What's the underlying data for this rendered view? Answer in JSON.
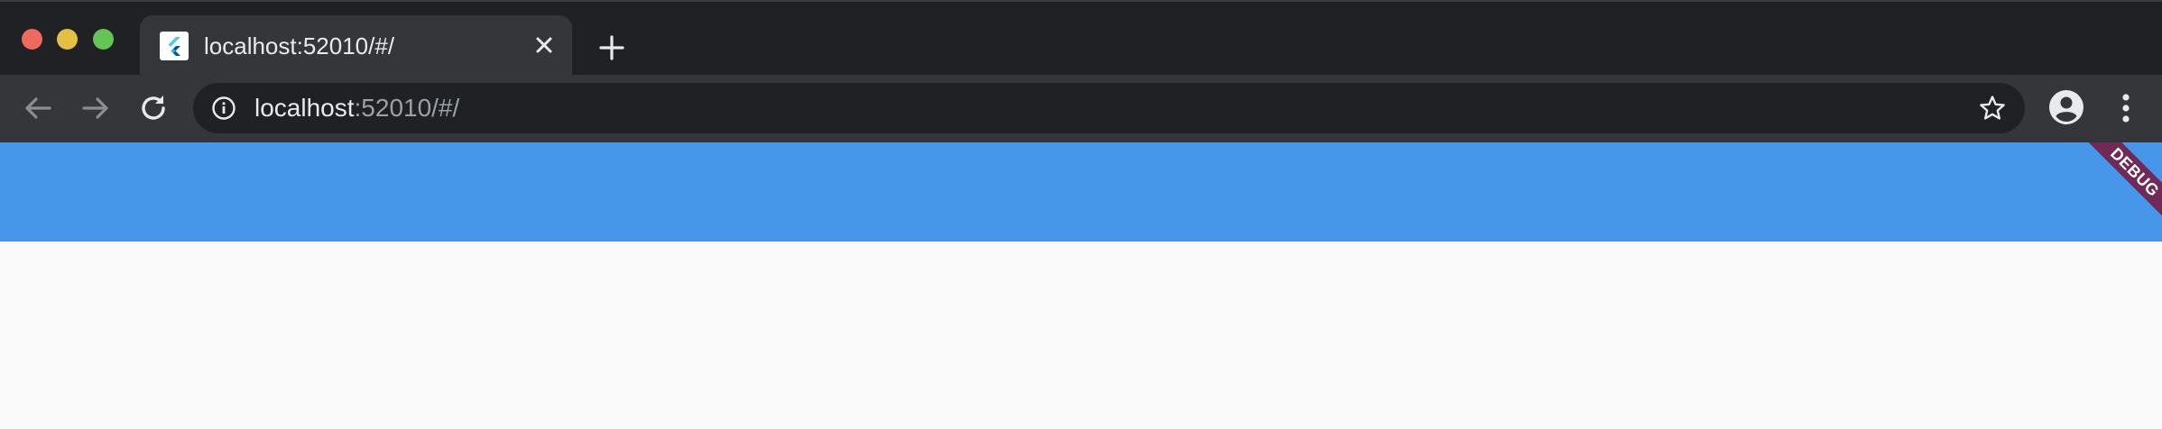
{
  "window": {
    "traffic_lights": {
      "close": "#ed6a5e",
      "minimize": "#e5bf3f",
      "maximize": "#62c554"
    }
  },
  "tab": {
    "title": "localhost:52010/#/",
    "favicon": "flutter-logo-icon",
    "close_icon": "close-icon"
  },
  "new_tab_icon": "plus-icon",
  "toolbar": {
    "back_icon": "arrow-left-icon",
    "forward_icon": "arrow-right-icon",
    "reload_icon": "reload-icon",
    "address": {
      "host": "localhost",
      "rest": ":52010/#/"
    },
    "info_icon": "info-icon",
    "star_icon": "star-icon",
    "profile_icon": "account-circle-icon",
    "menu_icon": "more-vert-icon"
  },
  "app": {
    "appbar_color": "#4696e9",
    "debug_banner": "DEBUG",
    "background": "#fafafa"
  }
}
